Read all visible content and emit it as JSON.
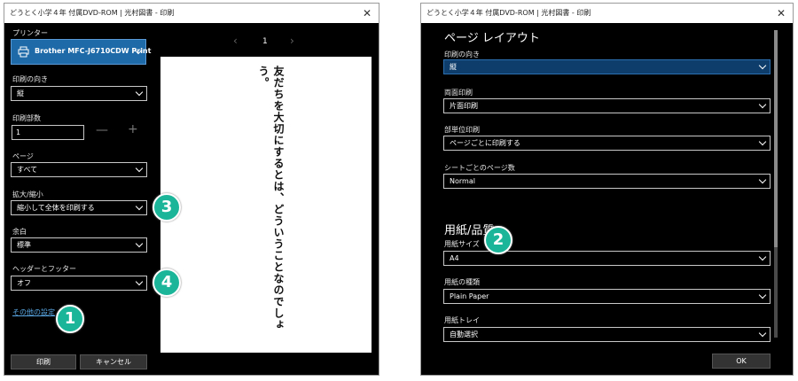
{
  "window1": {
    "title": "どうとく小学４年 付属DVD-ROM | 光村図書 - 印刷",
    "printer_label": "プリンター",
    "printer_name": "Brother MFC-J6710CDW Print",
    "orientation_label": "印刷の向き",
    "orientation_value": "縦",
    "copies_label": "印刷部数",
    "copies_value": "1",
    "copies_minus": "—",
    "copies_plus": "+",
    "pages_label": "ページ",
    "pages_value": "すべて",
    "scale_label": "拡大/縮小",
    "scale_value": "縮小して全体を印刷する",
    "margins_label": "余白",
    "margins_value": "標準",
    "header_footer_label": "ヘッダーとフッター",
    "header_footer_value": "オフ",
    "more_settings_link": "その他の設定",
    "print_button": "印刷",
    "cancel_button": "キャンセル",
    "page_number": "1",
    "prev_arrow": "‹",
    "next_arrow": "›",
    "preview_text": "友だちを大切にするとは、どういうことなのでしょう。"
  },
  "window2": {
    "title": "どうとく小学４年 付属DVD-ROM | 光村図書 - 印刷",
    "layout_heading": "ページ レイアウト",
    "orientation_label": "印刷の向き",
    "orientation_value": "縦",
    "duplex_label": "両面印刷",
    "duplex_value": "片面印刷",
    "collate_label": "部単位印刷",
    "collate_value": "ページごとに印刷する",
    "pages_per_sheet_label": "シートごとのページ数",
    "pages_per_sheet_value": "Normal",
    "paper_heading": "用紙/品質",
    "paper_size_label": "用紙サイズ",
    "paper_size_value": "A4",
    "paper_type_label": "用紙の種類",
    "paper_type_value": "Plain Paper",
    "paper_tray_label": "用紙トレイ",
    "paper_tray_value": "自動選択",
    "ok_button": "OK"
  },
  "close_glyph": "✕",
  "badges": {
    "b1": "1",
    "b2": "2",
    "b3": "3",
    "b4": "4"
  },
  "colors": {
    "accent": "#1e6aa8",
    "badge": "#1bb69a",
    "link": "#5aa9e6"
  }
}
